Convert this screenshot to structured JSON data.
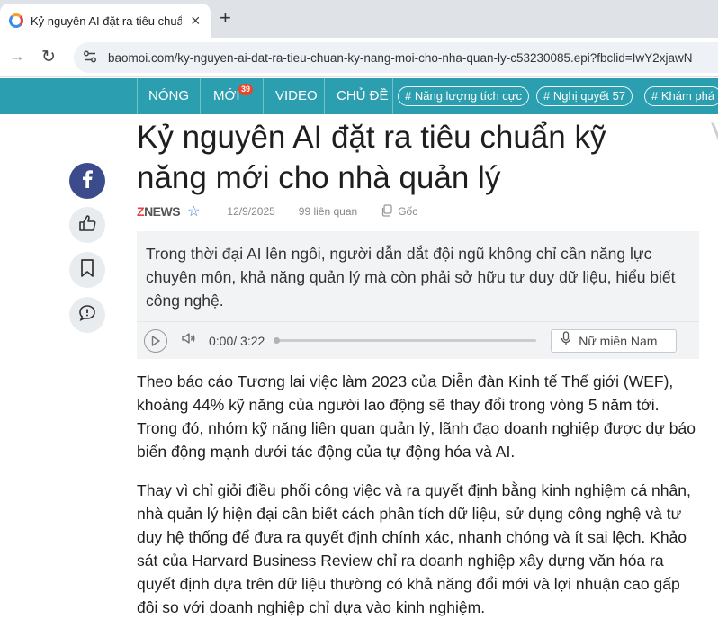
{
  "browser": {
    "tab_title": "Kỷ nguyên AI đặt ra tiêu chuẩn",
    "new_tab_label": "+",
    "url": "baomoi.com/ky-nguyen-ai-dat-ra-tieu-chuan-ky-nang-moi-cho-nha-quan-ly-c53230085.epi?fbclid=IwY2xjawN"
  },
  "nav": {
    "items": [
      "NÓNG",
      "MỚI",
      "VIDEO",
      "CHỦ ĐỀ"
    ],
    "new_badge": "39",
    "tags": [
      "# Năng lượng tích cực",
      "# Nghị quyết 57",
      "# Khám phá"
    ]
  },
  "article": {
    "headline": "Kỷ nguyên AI đặt ra tiêu chuẩn kỹ năng mới cho nhà quản lý",
    "source_z": "Z",
    "source_rest": "NEWS",
    "date": "12/9/2025",
    "related": "99 liên quan",
    "original": "Gốc",
    "summary": "Trong thời đại AI lên ngôi, người dẫn dắt đội ngũ không chỉ cần năng lực chuyên môn, khả năng quản lý mà còn phải sở hữu tư duy dữ liệu, hiểu biết công nghệ.",
    "audio": {
      "time": "0:00/ 3:22",
      "progress": 0,
      "voice": "Nữ miền Nam"
    },
    "paragraphs": [
      "Theo báo cáo Tương lai việc làm 2023 của Diễn đàn Kinh tế Thế giới (WEF), khoảng 44% kỹ năng của người lao động sẽ thay đổi trong vòng 5 năm tới. Trong đó, nhóm kỹ năng liên quan quản lý, lãnh đạo doanh nghiệp được dự báo biến động mạnh dưới tác động của tự động hóa và AI.",
      "Thay vì chỉ giỏi điều phối công việc và ra quyết định bằng kinh nghiệm cá nhân, nhà quản lý hiện đại cần biết cách phân tích dữ liệu, sử dụng công nghệ và tư duy hệ thống để đưa ra quyết định chính xác, nhanh chóng và ít sai lệch. Khảo sát của Harvard Business Review chỉ ra doanh nghiệp xây dựng văn hóa ra quyết định dựa trên dữ liệu thường có khả năng đổi mới và lợi nhuận cao gấp đôi so với doanh nghiệp chỉ dựa vào kinh nghiệm."
    ]
  },
  "colors": {
    "nav_bg": "#2b9fb0",
    "badge": "#e8472b",
    "facebook": "#3c4b8c",
    "summary_bg": "#f1f3f5"
  },
  "icons": [
    "forward-icon",
    "reload-icon",
    "site-settings-icon",
    "facebook-icon",
    "like-icon",
    "bookmark-icon",
    "comment-icon",
    "star-icon",
    "copy-icon",
    "play-icon",
    "volume-icon",
    "microphone-icon"
  ]
}
